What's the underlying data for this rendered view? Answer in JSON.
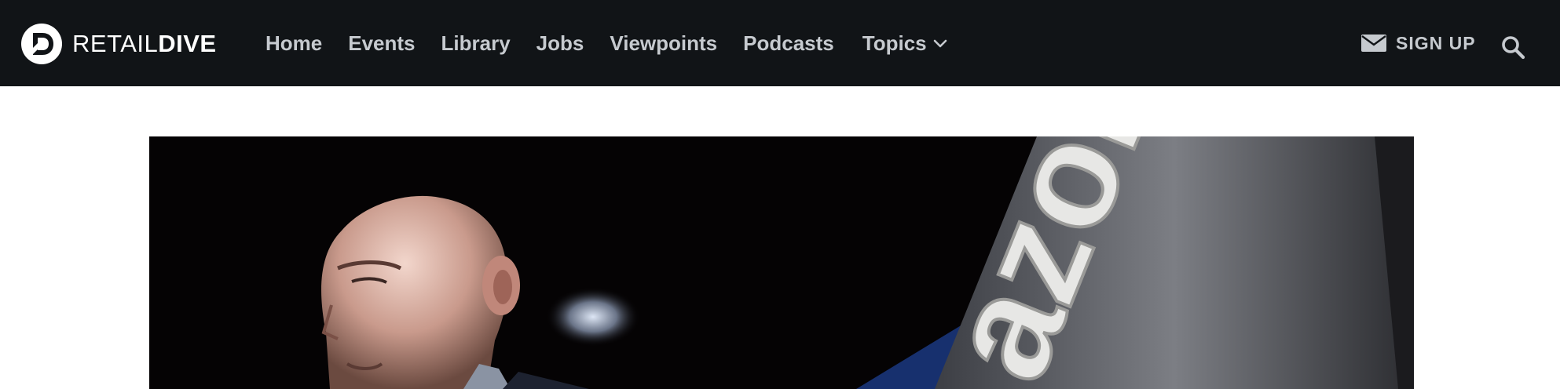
{
  "brand": {
    "name_light": "RETAIL",
    "name_bold": "DIVE",
    "logo_icon": "retail-dive-d-logo-icon"
  },
  "nav": {
    "items": [
      {
        "label": "Home"
      },
      {
        "label": "Events"
      },
      {
        "label": "Library"
      },
      {
        "label": "Jobs"
      },
      {
        "label": "Viewpoints"
      },
      {
        "label": "Podcasts"
      }
    ],
    "topics_label": "Topics",
    "topics_icon": "chevron-down-icon"
  },
  "signup": {
    "label": "SIGN UP",
    "icon": "mail-icon"
  },
  "search": {
    "icon": "search-icon"
  },
  "hero": {
    "image": "photo-speaker-in-front-of-amazon-sign",
    "sign_text": "azon"
  },
  "colors": {
    "header_bg": "#111417",
    "nav_text": "#c6cacf",
    "page_bg": "#ffffff"
  }
}
